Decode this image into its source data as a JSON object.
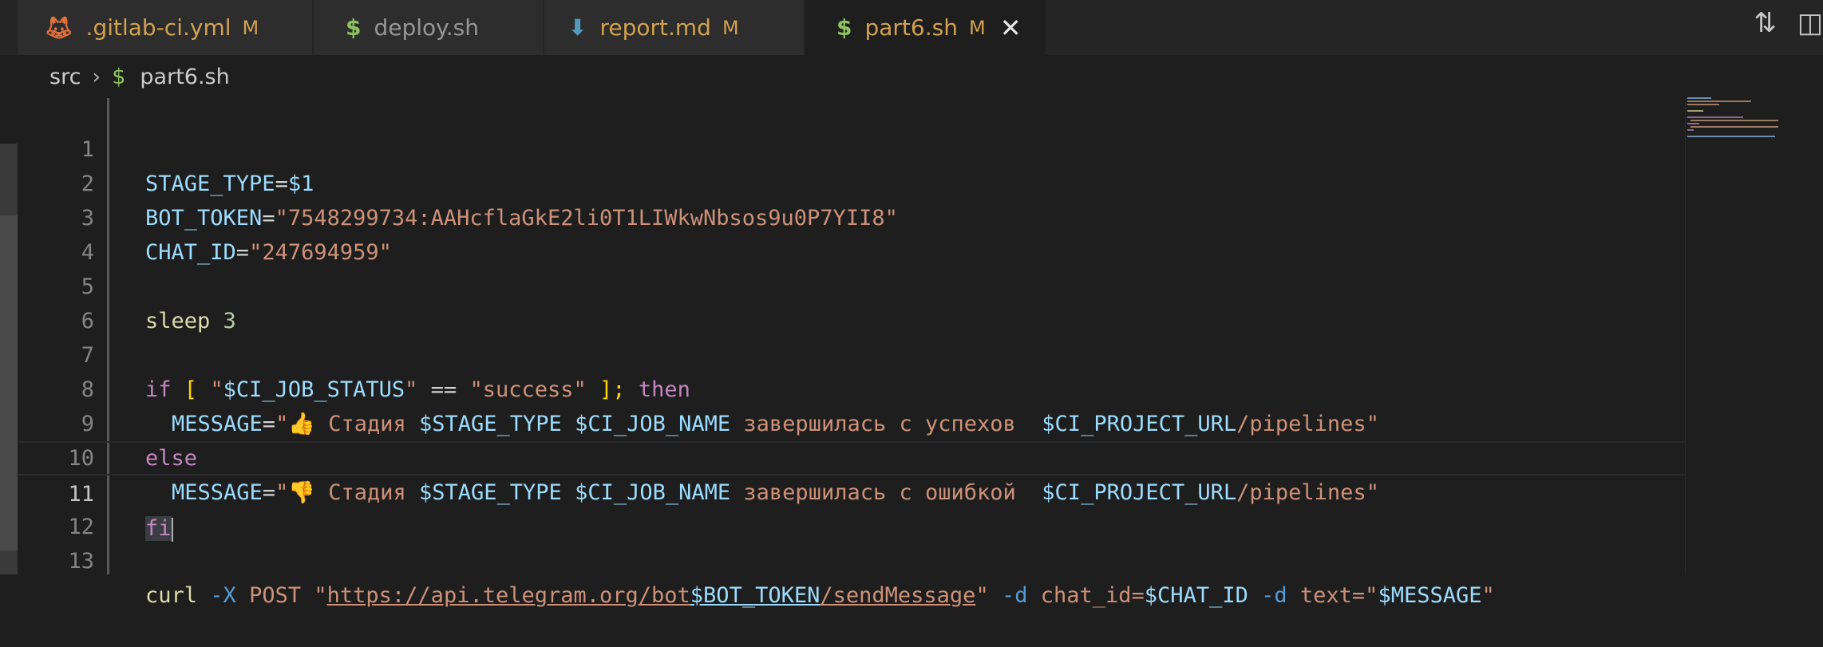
{
  "tabs": [
    {
      "icon": "gitlab-icon",
      "label": ".gitlab-ci.yml",
      "mod": "M"
    },
    {
      "icon": "dollar-icon",
      "label": "deploy.sh",
      "mod": ""
    },
    {
      "icon": "markdown-icon",
      "label": "report.md",
      "mod": "M"
    },
    {
      "icon": "dollar-icon",
      "label": "part6.sh",
      "mod": "M",
      "active": true
    }
  ],
  "breadcrumb": {
    "folder": "src",
    "file": "part6.sh"
  },
  "editor": {
    "line_numbers": [
      "1",
      "2",
      "3",
      "4",
      "5",
      "6",
      "7",
      "8",
      "9",
      "10",
      "11",
      "12",
      "13"
    ],
    "current_line": 11
  },
  "code": {
    "l1": {
      "var": "STAGE_TYPE",
      "eq": "=",
      "val": "$1"
    },
    "l2": {
      "var": "BOT_TOKEN",
      "eq": "=",
      "val": "\"7548299734:AAHcflaGkE2li0T1LIWkwNbsos9u0P7YII8\""
    },
    "l3": {
      "var": "CHAT_ID",
      "eq": "=",
      "val": "\"247694959\""
    },
    "l5": {
      "cmd": "sleep",
      "arg": "3"
    },
    "l7": {
      "kw_if": "if",
      "br_open": "[",
      "s1": "\"",
      "v1": "$CI_JOB_STATUS",
      "s2": "\"",
      "op": "==",
      "s3": "\"success\"",
      "br_close": "];",
      "kw_then": "then"
    },
    "l8": {
      "var": "MESSAGE",
      "eq": "=",
      "q": "\"",
      "emoji": "👍",
      "t1": " Стадия ",
      "v1": "$STAGE_TYPE",
      "sp": " ",
      "v2": "$CI_JOB_NAME",
      "t2": " завершилась с успехов  ",
      "v3": "$CI_PROJECT_URL",
      "t3": "/pipelines\""
    },
    "l9": {
      "kw": "else"
    },
    "l10": {
      "var": "MESSAGE",
      "eq": "=",
      "q": "\"",
      "emoji": "👎",
      "t1": " Стадия ",
      "v1": "$STAGE_TYPE",
      "sp": " ",
      "v2": "$CI_JOB_NAME",
      "t2": " завершилась с ошибкой  ",
      "v3": "$CI_PROJECT_URL",
      "t3": "/pipelines\""
    },
    "l11": {
      "kw": "fi"
    },
    "l13": {
      "cmd": "curl",
      "f1": "-X",
      "m": "POST",
      "q1": "\"",
      "url1": "https://api.telegram.org/bot",
      "url2": "$BOT_TOKEN",
      "url3": "/sendMessage",
      "q2": "\"",
      "f2": "-d",
      "a1": "chat_id=",
      "v1": "$CHAT_ID",
      "f3": "-d",
      "a2": "text=",
      "q3": "\"",
      "v2": "$MESSAGE",
      "q4": "\""
    }
  },
  "colors": {
    "background": "#1e1e1e",
    "tab_modified": "#d2a14f",
    "accent_shell": "#8fc35e"
  }
}
